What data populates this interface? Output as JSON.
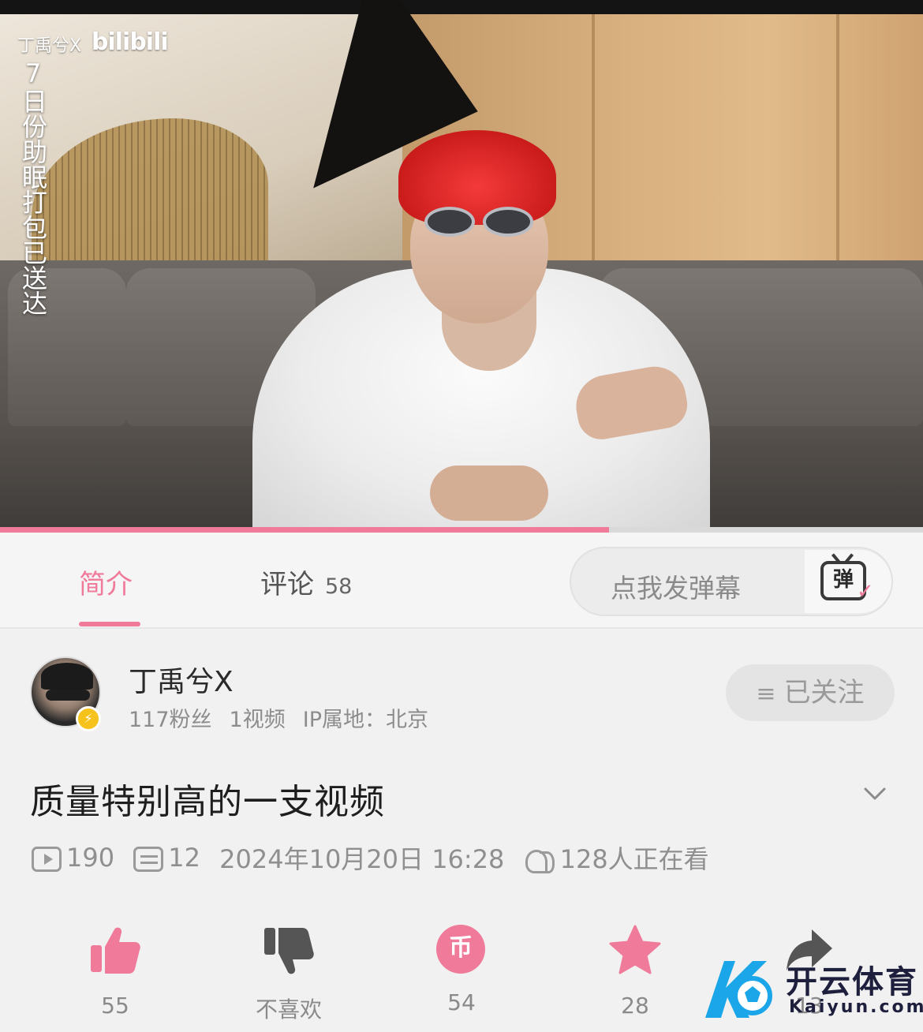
{
  "video": {
    "overlay_uploader": "丁禹兮X",
    "overlay_logo": "bilibili",
    "overlay_caption": "7日份助眠打包已送达",
    "progress_fraction": 0.66
  },
  "tabs": {
    "intro": "简介",
    "comments": "评论",
    "comments_count": "58"
  },
  "danmaku": {
    "placeholder": "点我发弹幕",
    "icon_char": "弹"
  },
  "uploader": {
    "name": "丁禹兮X",
    "fans": "117粉丝",
    "videos": "1视频",
    "ip": "IP属地：北京",
    "follow_label": "已关注",
    "follow_icon": "≡"
  },
  "video_info": {
    "title": "质量特别高的一支视频",
    "plays": "190",
    "danmaku_count": "12",
    "datetime": "2024年10月20日 16:28",
    "watching": "128人正在看"
  },
  "actions": {
    "like": "55",
    "dislike": "不喜欢",
    "coin": "54",
    "coin_char": "币",
    "favorite": "28",
    "share": "13"
  },
  "colors": {
    "accent_pink": "#f07a9a",
    "text_gray": "#8f8f8f"
  },
  "watermark": {
    "brand": "开云体育",
    "domain": "Kaiyun.com"
  }
}
